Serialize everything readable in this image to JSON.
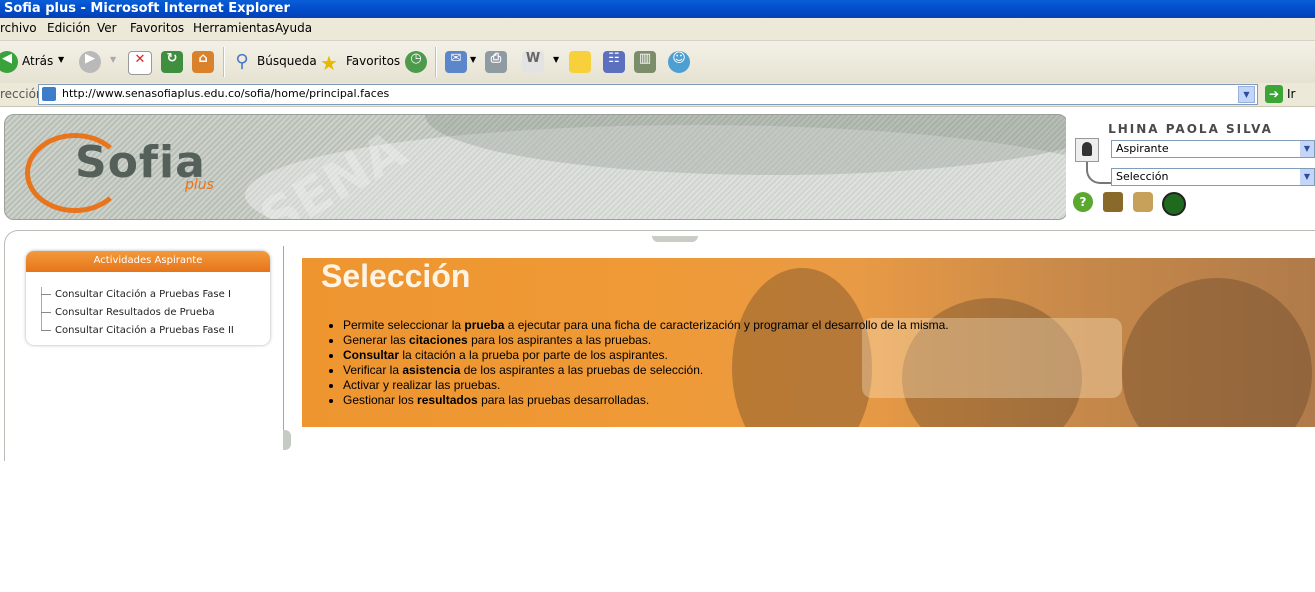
{
  "window": {
    "title": "Sofia plus - Microsoft Internet Explorer"
  },
  "menu": [
    "rchivo",
    "Edición",
    "Ver",
    "Favoritos",
    "Herramientas",
    "Ayuda"
  ],
  "toolbar": {
    "back_label": "Atrás",
    "search_label": "Búsqueda",
    "favorites_label": "Favoritos"
  },
  "address": {
    "label": "rección",
    "url": "http://www.senasofiaplus.edu.co/sofia/home/principal.faces",
    "go_label": "Ir"
  },
  "header": {
    "logo_text": "Sofia",
    "logo_sub": "plus",
    "watermark": "SENA",
    "user_name": "LHINA PAOLA SILVA",
    "role_select": "Aspirante",
    "module_select": "Selección"
  },
  "sidebar": {
    "title": "Actividades Aspirante",
    "items": [
      "Consultar Citación a Pruebas Fase I",
      "Consultar Resultados de Prueba",
      "Consultar Citación a Pruebas Fase II"
    ]
  },
  "main": {
    "title": "Selección",
    "bullets": [
      {
        "pre": "Permite seleccionar la ",
        "bold": "prueba",
        "post": " a ejecutar para una ficha de caracterización y programar el desarrollo de la misma."
      },
      {
        "pre": "Generar las ",
        "bold": "citaciones",
        "post": " para los aspirantes a las pruebas."
      },
      {
        "pre": "",
        "bold": "Consultar",
        "post": " la citación a la prueba por parte de los aspirantes."
      },
      {
        "pre": "Verificar la ",
        "bold": "asistencia",
        "post": " de los aspirantes a las pruebas de selección."
      },
      {
        "pre": "Activar y realizar las pruebas.",
        "bold": "",
        "post": ""
      },
      {
        "pre": "Gestionar los ",
        "bold": "resultados",
        "post": " para las pruebas desarrolladas."
      }
    ]
  },
  "colors": {
    "accent": "#e8741c",
    "hero": "#ee9530",
    "titlebar": "#0453d0"
  }
}
